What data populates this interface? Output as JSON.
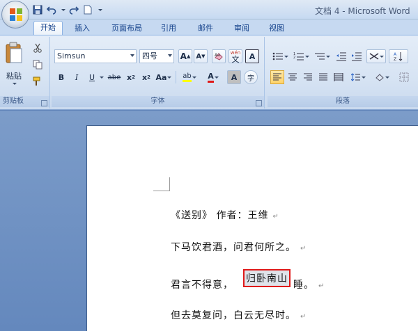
{
  "window": {
    "title": "文档 4 - Microsoft Word"
  },
  "tabs": [
    {
      "label": "开始",
      "active": true
    },
    {
      "label": "插入"
    },
    {
      "label": "页面布局"
    },
    {
      "label": "引用"
    },
    {
      "label": "邮件"
    },
    {
      "label": "审阅"
    },
    {
      "label": "视图"
    }
  ],
  "clipboard": {
    "paste_label": "粘贴",
    "group_label": "剪贴板"
  },
  "font": {
    "font_name": "Simsun",
    "font_size": "四号",
    "group_label": "字体",
    "phonetic_label": "wén",
    "phonetic_char": "文",
    "border_char": "A",
    "grow": "A",
    "shrink": "A",
    "bold": "B",
    "italic": "I",
    "underline": "U",
    "strike": "abe",
    "subscript": "x",
    "superscript": "x",
    "case": "Aa",
    "highlight": "ab",
    "color": "A",
    "shade": "A",
    "circle": "字"
  },
  "paragraph": {
    "group_label": "段落"
  },
  "document": {
    "lines": [
      "《送别》 作者：王维",
      "下马饮君酒，问君何所之。",
      "君言不得意，",
      "但去莫复问，白云无尽时。"
    ],
    "line3_tail": "睡。",
    "highlighted_text": "归卧南山",
    "paragraph_mark": "↵"
  },
  "colors": {
    "accent": "#e01818",
    "ribbon": "#d6e3f3",
    "tab_text": "#15428b"
  }
}
